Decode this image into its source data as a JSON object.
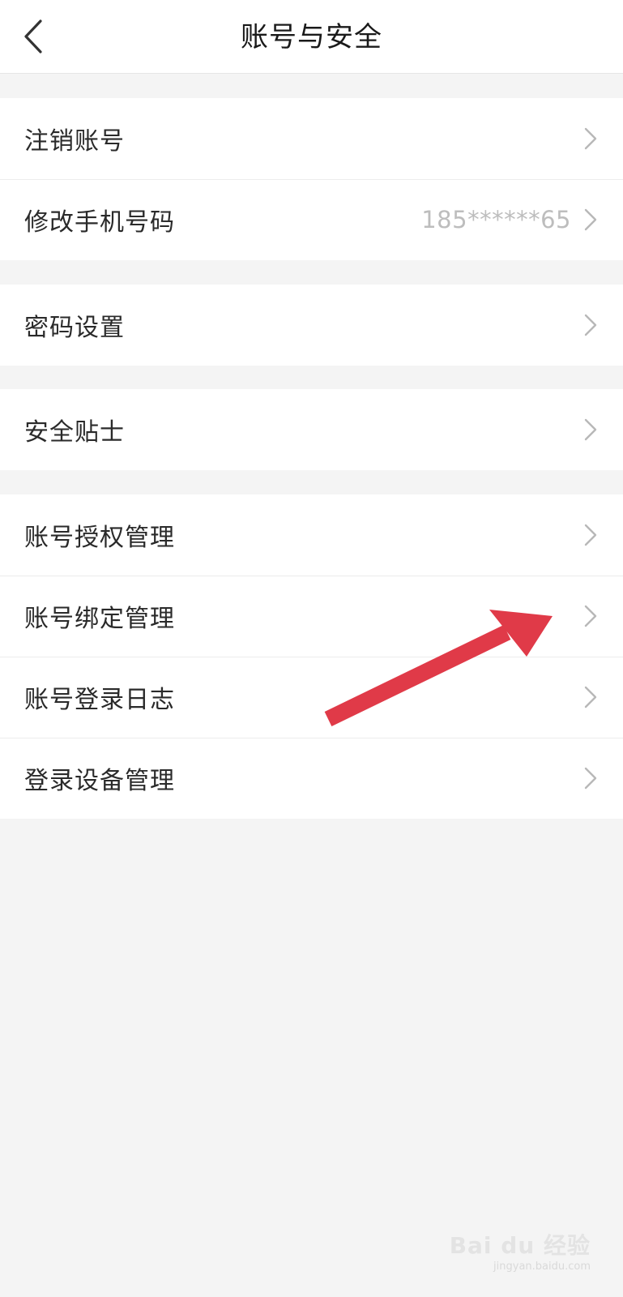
{
  "header": {
    "title": "账号与安全"
  },
  "groups": [
    {
      "items": [
        {
          "label": "注销账号",
          "value": ""
        },
        {
          "label": "修改手机号码",
          "value": "185******65"
        }
      ]
    },
    {
      "items": [
        {
          "label": "密码设置",
          "value": ""
        }
      ]
    },
    {
      "items": [
        {
          "label": "安全贴士",
          "value": ""
        }
      ]
    },
    {
      "items": [
        {
          "label": "账号授权管理",
          "value": ""
        },
        {
          "label": "账号绑定管理",
          "value": ""
        },
        {
          "label": "账号登录日志",
          "value": ""
        },
        {
          "label": "登录设备管理",
          "value": ""
        }
      ]
    }
  ],
  "watermark": {
    "text": "Bai du 经验",
    "subtext": "jingyan.baidu.com"
  },
  "colors": {
    "background": "#f4f4f4",
    "row_background": "#ffffff",
    "label": "#2a2a2a",
    "value": "#bdbdbd",
    "chevron": "#b8b8b8",
    "annotation_arrow": "#e03a48"
  },
  "icons": {
    "back": "chevron-left-icon",
    "row_arrow": "chevron-right-icon"
  }
}
